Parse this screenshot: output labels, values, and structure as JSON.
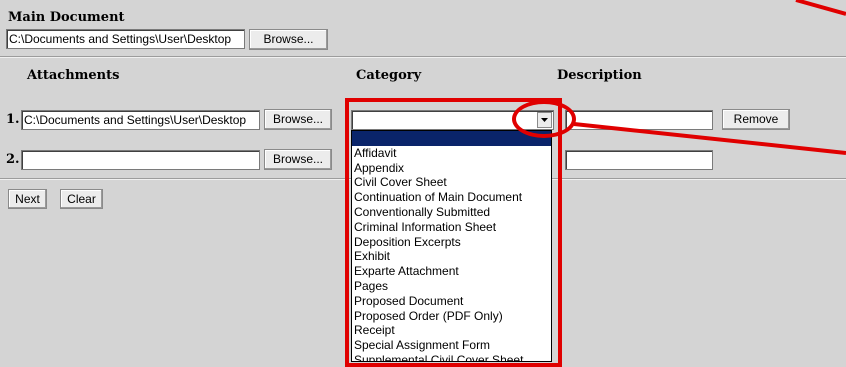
{
  "main_document": {
    "label": "Main Document",
    "path_value": "C:\\Documents and Settings\\User\\Desktop",
    "browse_label": "Browse..."
  },
  "table_headers": {
    "attachments": "Attachments",
    "category": "Category",
    "description": "Description"
  },
  "rows": [
    {
      "num": "1.",
      "path_value": "C:\\Documents and Settings\\User\\Desktop",
      "browse_label": "Browse...",
      "category_value": "",
      "description_value": "",
      "remove_label": "Remove"
    },
    {
      "num": "2.",
      "path_value": "",
      "browse_label": "Browse...",
      "category_value": "",
      "description_value": ""
    }
  ],
  "actions": {
    "next_label": "Next",
    "clear_label": "Clear"
  },
  "category_options": [
    "",
    "Affidavit",
    "Appendix",
    "Civil Cover Sheet",
    "Continuation of Main Document",
    "Conventionally Submitted",
    "Criminal Information Sheet",
    "Deposition Excerpts",
    "Exhibit",
    "Exparte Attachment",
    "Pages",
    "Proposed Document",
    "Proposed Order (PDF Only)",
    "Receipt",
    "Special Assignment Form",
    "Supplemental Civil Cover Sheet"
  ],
  "icons": {
    "dropdown_arrow": "chevron-down-icon"
  },
  "colors": {
    "background": "#d4d4d4",
    "highlight_annotation": "#e00000",
    "selected_option": "#0a246a"
  }
}
